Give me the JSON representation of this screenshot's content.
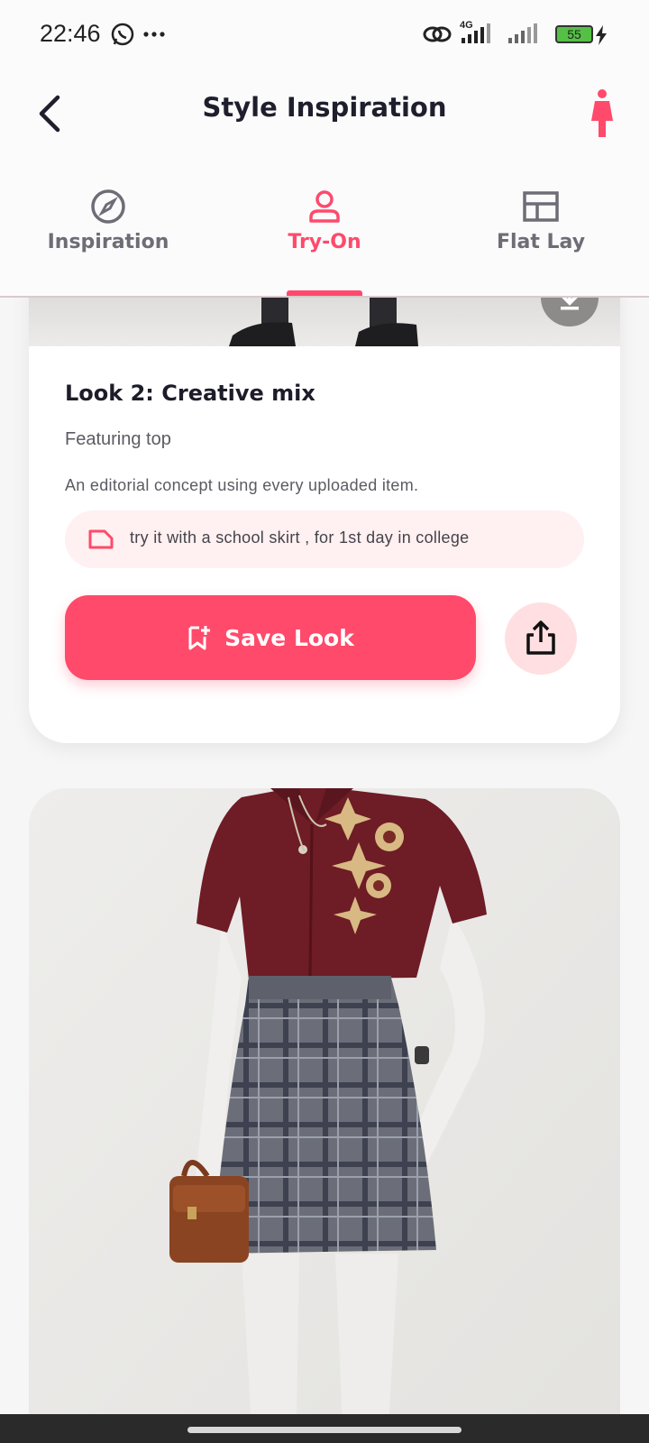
{
  "status_bar": {
    "time": "22:46",
    "network": "4G",
    "battery": "55",
    "icons": [
      "whatsapp-icon",
      "more-dots-icon",
      "link-icon",
      "signal-4g-icon",
      "signal-icon",
      "battery-icon",
      "charging-icon"
    ]
  },
  "app_bar": {
    "title": "Style Inspiration",
    "back_icon": "chevron-left-icon",
    "action_icon": "person-figure-icon",
    "accent_color": "#ff4a6b"
  },
  "tabs": [
    {
      "label": "Inspiration",
      "icon": "compass-icon",
      "active": false
    },
    {
      "label": "Try-On",
      "icon": "person-icon",
      "active": true
    },
    {
      "label": "Flat Lay",
      "icon": "layout-icon",
      "active": false
    }
  ],
  "look_card": {
    "title": "Look 2: Creative mix",
    "feature": "Featuring top",
    "description": "An editorial concept using every uploaded item.",
    "prompt": "try it with a school skirt , for 1st day in college",
    "prompt_icon": "label-tag-icon",
    "save_label": "Save Look",
    "save_icon": "bookmark-add-icon",
    "share_icon": "share-icon",
    "download_icon": "download-icon"
  },
  "photo_card": {
    "image": "mannequin-outfit-photo"
  }
}
